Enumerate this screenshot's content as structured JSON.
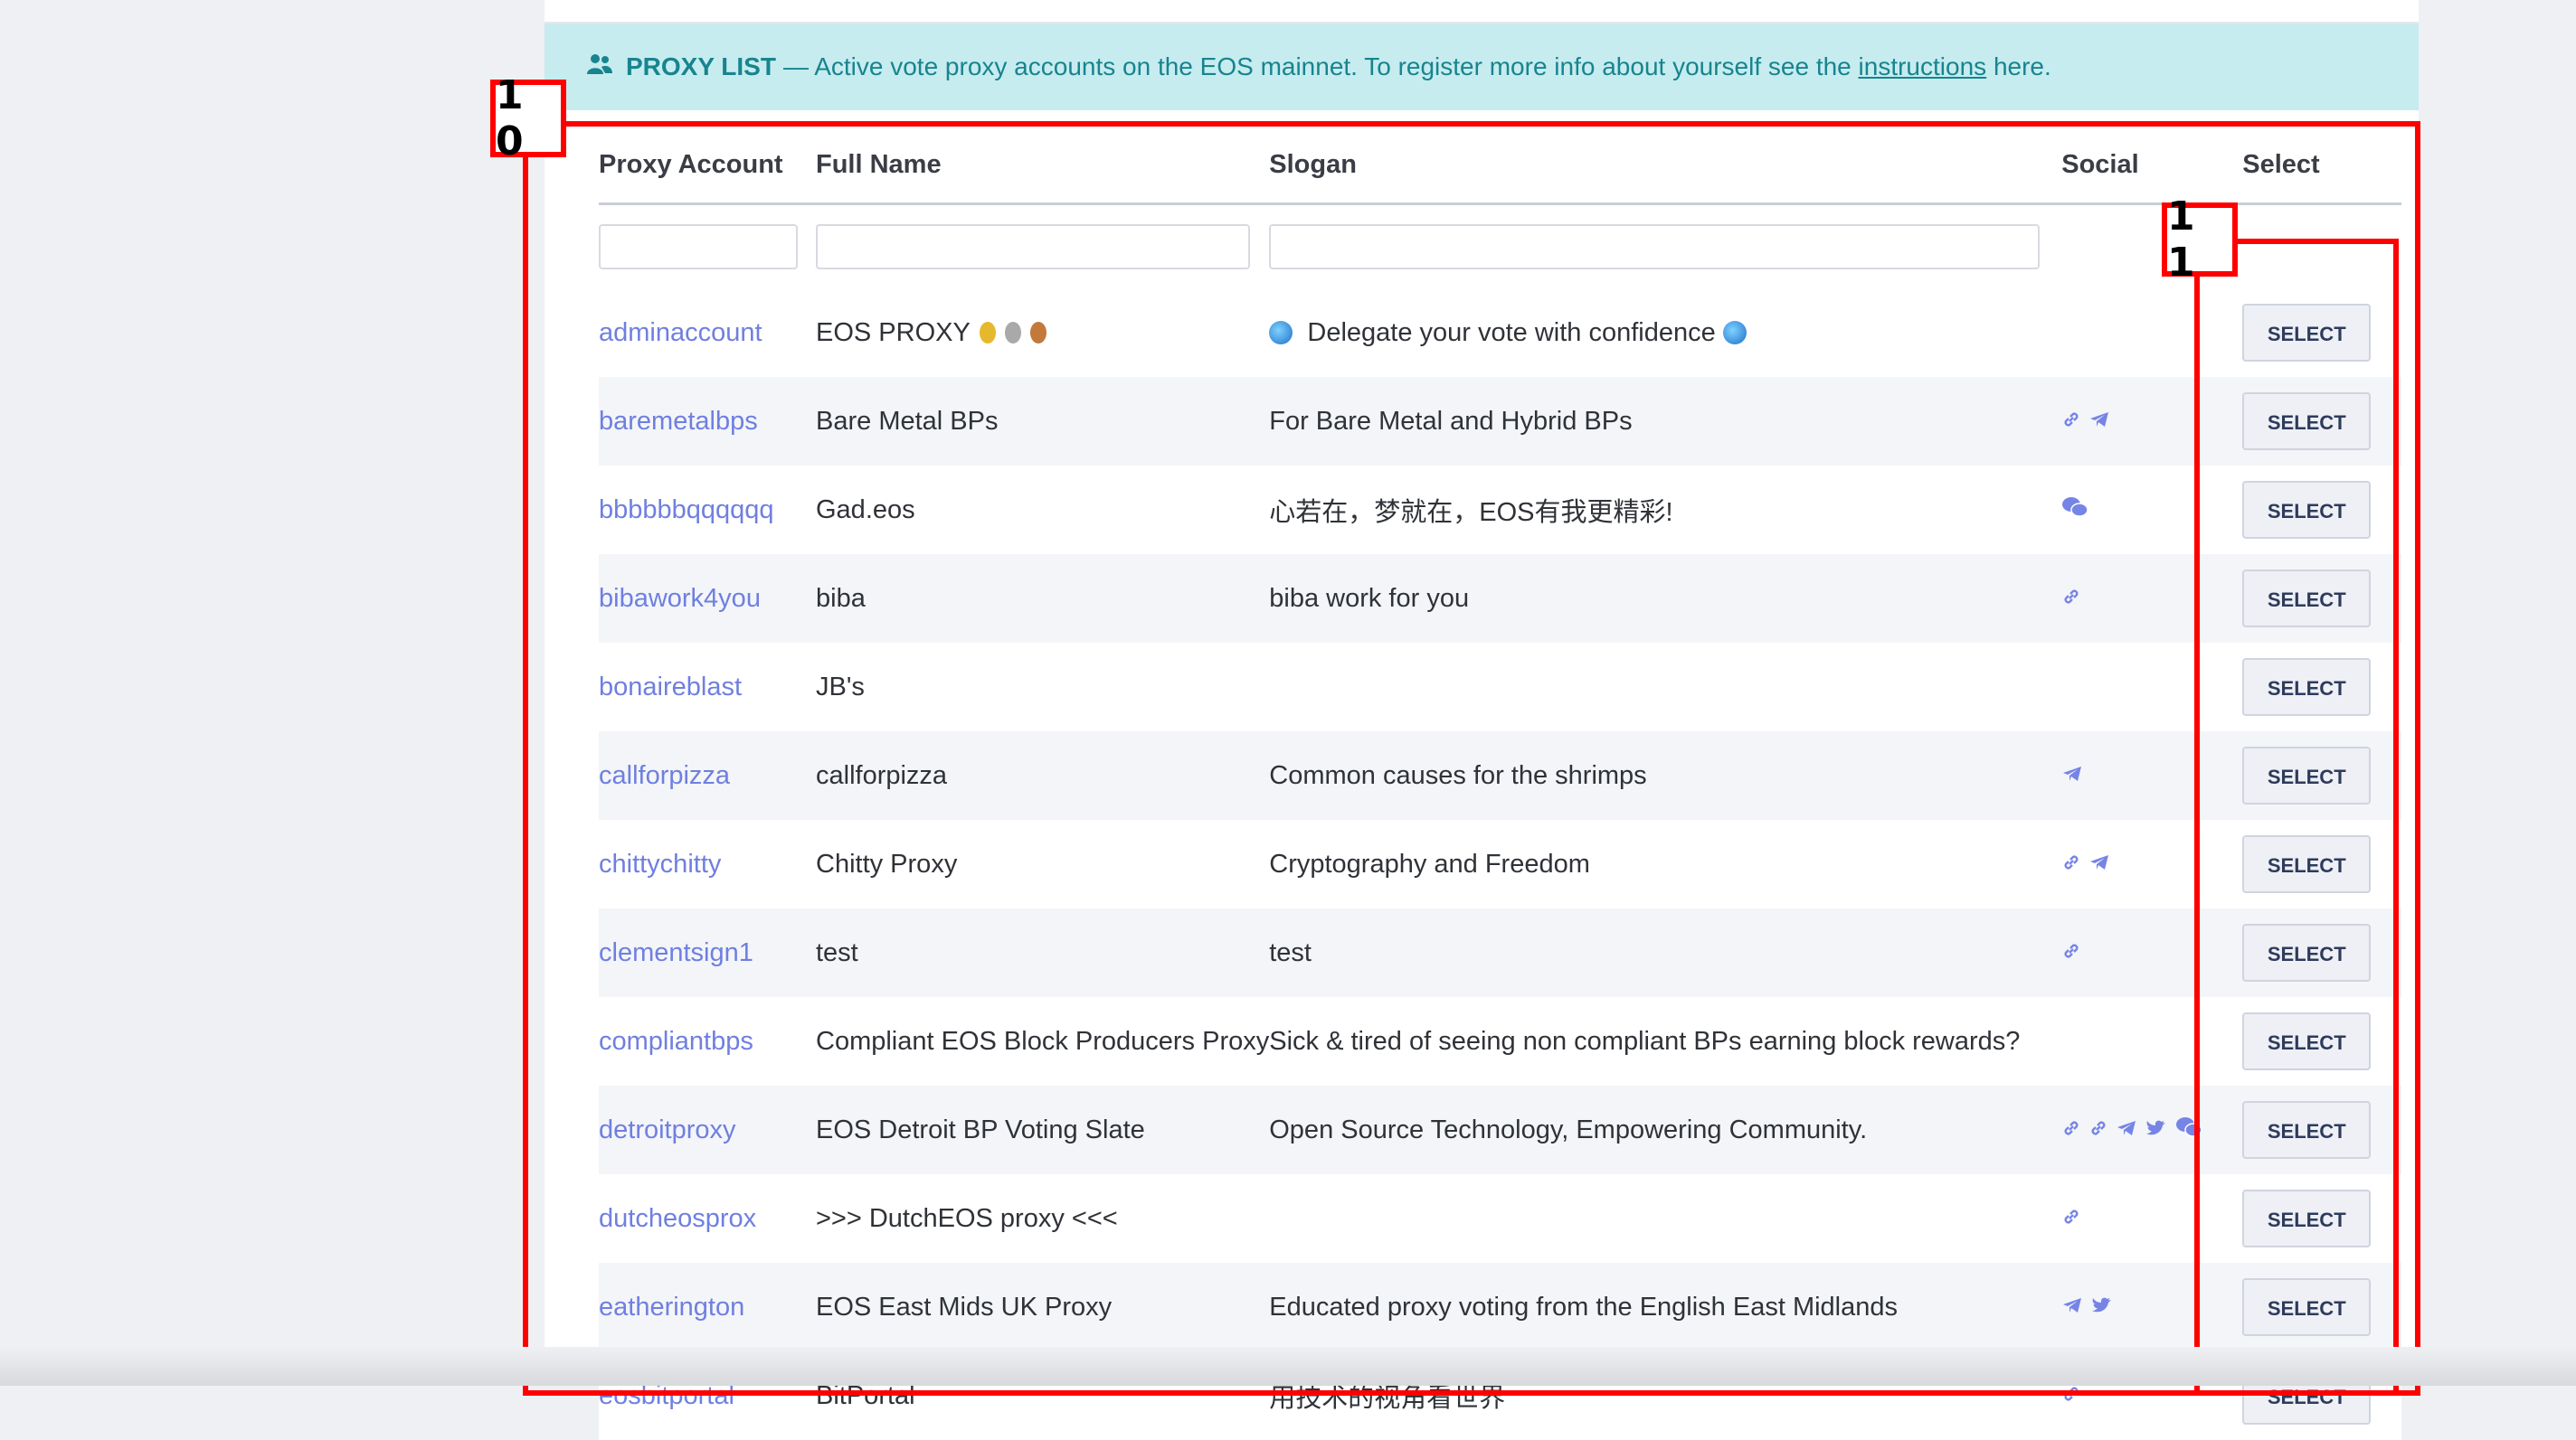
{
  "banner": {
    "title": "PROXY LIST",
    "text": "— Active vote proxy accounts on the EOS mainnet. To register more info about yourself see the",
    "link": "instructions",
    "suffix": "here."
  },
  "columns": [
    "Proxy Account",
    "Full Name",
    "Slogan",
    "Social",
    "Select"
  ],
  "rows": [
    {
      "account": "adminaccount",
      "name": "EOS PROXY",
      "slogan": "Delegate your vote with confidence",
      "social": [],
      "select": "SELECT"
    },
    {
      "account": "baremetalbps",
      "name": "Bare Metal BPs",
      "slogan": "For Bare Metal and Hybrid BPs",
      "social": [
        "link-icon",
        "telegram-icon"
      ],
      "select": "SELECT"
    },
    {
      "account": "bbbbbbqqqqqq",
      "name": "Gad.eos",
      "slogan": "心若在，梦就在，EOS有我更精彩!",
      "social": [
        "wechat-icon"
      ],
      "select": "SELECT"
    },
    {
      "account": "bibawork4you",
      "name": "biba",
      "slogan": "biba work for you",
      "social": [
        "link-icon"
      ],
      "select": "SELECT"
    },
    {
      "account": "bonaireblast",
      "name": "JB's",
      "slogan": "",
      "social": [],
      "select": "SELECT"
    },
    {
      "account": "callforpizza",
      "name": "callforpizza",
      "slogan": "Common causes for the shrimps",
      "social": [
        "telegram-icon"
      ],
      "select": "SELECT"
    },
    {
      "account": "chittychitty",
      "name": "Chitty Proxy",
      "slogan": "Cryptography and Freedom",
      "social": [
        "link-icon",
        "telegram-icon"
      ],
      "select": "SELECT"
    },
    {
      "account": "clementsign1",
      "name": "test",
      "slogan": "test",
      "social": [
        "link-icon"
      ],
      "select": "SELECT"
    },
    {
      "account": "compliantbps",
      "name": "Compliant EOS Block Producers Proxy",
      "slogan": "Sick & tired of seeing non compliant BPs earning block rewards?",
      "social": [],
      "select": "SELECT"
    },
    {
      "account": "detroitproxy",
      "name": "EOS Detroit BP Voting Slate",
      "slogan": "Open Source Technology, Empowering Community.",
      "social": [
        "link-icon",
        "link-icon",
        "telegram-icon",
        "twitter-icon",
        "wechat-icon"
      ],
      "select": "SELECT"
    },
    {
      "account": "dutcheosprox",
      "name": ">>> DutchEOS proxy <<<",
      "slogan": "",
      "social": [
        "link-icon"
      ],
      "select": "SELECT"
    },
    {
      "account": "eatherington",
      "name": "EOS East Mids UK Proxy",
      "slogan": "Educated proxy voting from the English East Midlands",
      "social": [
        "telegram-icon",
        "twitter-icon"
      ],
      "select": "SELECT"
    },
    {
      "account": "eosbitportal",
      "name": "BitPortal",
      "slogan": "用技术的视角看世界",
      "social": [
        "link-icon"
      ],
      "select": "SELECT"
    }
  ],
  "annotations": [
    {
      "label": "1 0"
    },
    {
      "label": "1 1"
    }
  ],
  "colors": {
    "accent": "#18848e",
    "banner_bg": "#c6ecef",
    "link": "#6f7fe0",
    "overlay": "#ff0000"
  }
}
